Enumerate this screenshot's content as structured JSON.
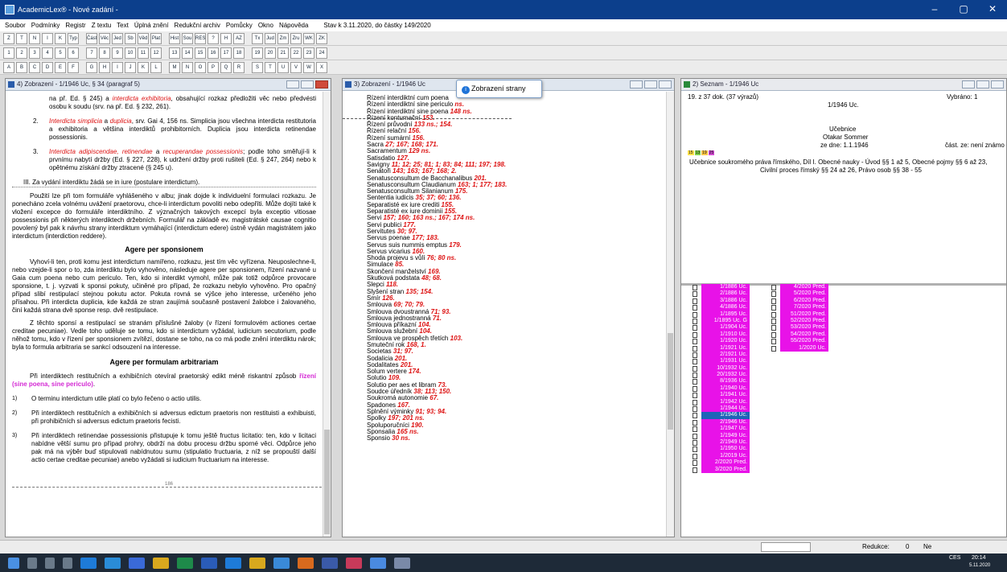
{
  "window": {
    "title": "AcademicLex® - Nové zadání -",
    "icon": "app-icon"
  },
  "menu": {
    "items": [
      "Soubor",
      "Podmínky",
      "Registr",
      "Z textu",
      "Text",
      "Úplná znění",
      "Redukční archiv",
      "Pomůcky",
      "Okno",
      "Nápověda"
    ],
    "stav": "Stav k 3.11.2020, do částky 149/2020"
  },
  "toolbar": {
    "row1": [
      "Z",
      "T",
      "N",
      "I",
      "K",
      "Typ",
      "Část",
      "Věc",
      "Jed",
      "Sb",
      "Věd",
      "Plat",
      "Hist",
      "Sou",
      "RESET",
      "?",
      "H",
      "AZ",
      "Tx",
      "Jud",
      "Zm",
      "Zru",
      "WK",
      "ZK"
    ],
    "row2": [
      "1",
      "2",
      "3",
      "4",
      "5",
      "6",
      "7",
      "8",
      "9",
      "10",
      "11",
      "12",
      "13",
      "14",
      "15",
      "16",
      "17",
      "18",
      "19",
      "20",
      "21",
      "22",
      "23",
      "24"
    ],
    "row3": [
      "A",
      "B",
      "C",
      "D",
      "E",
      "F",
      "G",
      "H",
      "I",
      "J",
      "K",
      "L",
      "M",
      "N",
      "O",
      "P",
      "Q",
      "R",
      "S",
      "T",
      "U",
      "V",
      "W",
      "X"
    ]
  },
  "pane1": {
    "title": "4) Zobrazení - 1/1946 Uc, § 34 (paragraf 5)",
    "p_top": "na př. Ed. § 245) a ",
    "p_top_red": "interdicta exhibitoria",
    "p_top_rest": ", obsahující rozkaz předložiti věc nebo předvésti osobu k soudu (srv. na př. Ed. § 232, 261).",
    "item2_num": "2.",
    "item2_red": "Interdicta simplicia",
    "item2_a": " a ",
    "item2_red2": "duplicia",
    "item2_rest": ", srv. Gai 4, 156 ns. Simplicia jsou všechna interdicta restitutoria a exhibitoria a většina interdiktů prohibitorních. Duplicia jsou interdicta retinendae possessionis.",
    "item3_num": "3.",
    "item3_red": "Interdicta adipiscendae, retinendae",
    "item3_a": " a ",
    "item3_red2": "recuperandae possessionis",
    "item3_rest": "; podle toho směřují-li k prvnímu nabytí držby (Ed. § 227, 228), k udržení držby proti rušiteli (Ed. § 247, 264) nebo k opětnému získání držby ztracené (§ 245 u).",
    "sec3": "III. Za vydání interdiktu žádá se in iure (postulare interdictum).",
    "para1": "Použití lze při tom formuláře vyhlášeného v albu; jinak dojde k individuelní formulaci rozkazu. Je ponecháno zcela volnému uvážení praetorovu, chce-li interdictum povoliti nebo odepříti. Může dojíti také k vložení excepce do formuláře interdiktního. Z význačných takových excepcí byla exceptio vitiosae possessionis při některých interdiktech držebních. Formulář na základě ev. magistrátské causae cognitio povolený byl pak k návrhu strany interdiktum vymáhající (interdictum edere) ústně vydán magistrátem jako interdictum (interdiction reddere).",
    "h1": "Agere per sponsionem",
    "para2": "Vyhoví-li ten, proti komu jest interdictum namířeno, rozkazu, jest tím věc vyřízena. Neuposlechne-li, nebo vzejde-li spor o to, zda interdiktu bylo vyhověno, následuje agere per sponsionem, řízení nazvané u Gaia cum poena nebo cum periculo. Ten, kdo si interdikt vymohl, může pak totiž odpůrce provocare sponsione, t. j. vyzvati k sponsi pokuty, učiněné pro případ, že rozkazu nebylo vyhověno. Pro opačný případ slibí restipulací stejnou pokutu actor. Pokuta rovná se výšce jeho interesse, určeného jeho přísahou. Při interdicta duplicia, kde každá ze stran zaujímá současně postavení žalobce i žalovaného, činí každá strana dvě sponse resp. dvě restipulace.",
    "para3": "Z těchto sponsí a restipulací se stranám příslušné žaloby (v řízení formulovém actiones certae creditae pecuniae). Vedle toho uděluje se tomu, kdo si interdictum vyžádal, iudicium secutorium, podle něhož tomu, kdo v řízení per sponsionem zvítězí, dostane se toho, na co má podle znění interdiktu nárok; byla to formula arbitraria se sankcí odsouzení na interesse.",
    "h2": "Agere per formulam arbitrariam",
    "para4a": "Při interdiktech restitučních a exhibičních otevíral praetorský edikt méně riskantní způsob ",
    "para4hl": "řízení (sine poena, sine periculo)",
    "para4b": ".",
    "fn1": "O terminu interdictum utile platí co bylo řečeno o actio utilis.",
    "fn1hl": "interdictum",
    "fn2": "Při interdiktech restitučních a exhibičních si adversus edictum praetoris non restituisti a exhibuisti, při prohibičních si adversus edictum praetoris fecisti.",
    "fn3": "Při interdiktech retinendae possessionis přistupuje k tomu ještě fructus licitatio: ten, kdo v licitaci nabídne větší sumu pro případ prohry, obdrží na dobu procesu držbu sporné věci. Odpůrce jeho pak má na výběr buď stipulovati nabídnutou sumu (stipulatio fructuaria, z níž se propouští další actio certae creditae pecuniae) anebo vyžádati si iudicium fructuarium na interesse.",
    "fnmarks": [
      "1)",
      "2)",
      "3)"
    ],
    "pageno": "186"
  },
  "pane2": {
    "title": "3) Zobrazení - 1/1946 Uc",
    "tooltip": "Zobrazení strany",
    "items": [
      [
        "Řízení interdiktní cum poena",
        ""
      ],
      [
        "Řízení interdiktní sine periculo",
        "ns."
      ],
      [
        "Řízení interdiktní sine poena",
        "148 ns."
      ],
      [
        "Řízení kontumační",
        "153."
      ],
      [
        "Řízení průvodní",
        "133 ns.; 154."
      ],
      [
        "Řízení relační",
        "156."
      ],
      [
        "Řízení sumární",
        "156."
      ],
      [
        "Sacra",
        "27; 167; 168; 171."
      ],
      [
        "Sacramentum",
        "129 ns."
      ],
      [
        "Satisdatio",
        "127."
      ],
      [
        "Savigny",
        "11; 12; 25; 81; 1; 83; 84; 111; 197; 198."
      ],
      [
        "Senátoři",
        "143; 163; 167; 168; 2."
      ],
      [
        "Senatusconsultum de Bacchanalibus",
        "201."
      ],
      [
        "Senatusconsultum Claudianum",
        "163; 1; 177; 183."
      ],
      [
        "Senatusconsultum Silanianum",
        "175."
      ],
      [
        "Sententia iudicis",
        "35; 37; 60; 136."
      ],
      [
        "Separatisté ex iure crediti",
        "155."
      ],
      [
        "Separatisté ex iure dominii",
        "155."
      ],
      [
        "Servi",
        "157; 160; 163 ns.; 167; 174 ns."
      ],
      [
        "Servi publici",
        "177."
      ],
      [
        "Servitutes",
        "30; 97."
      ],
      [
        "Servus poenae",
        "177; 183."
      ],
      [
        "Servus suis nummis emptus",
        "179."
      ],
      [
        "Servus vicarius",
        "160."
      ],
      [
        "Shoda projevu s vůlí",
        "76; 80 ns."
      ],
      [
        "Simulace",
        "85."
      ],
      [
        "Skončení manželství",
        "169."
      ],
      [
        "Skutková podstata",
        "48; 68."
      ],
      [
        "Slepci",
        "118."
      ],
      [
        "Slyšení stran",
        "135; 154."
      ],
      [
        "Smír",
        "126."
      ],
      [
        "Smlouva",
        "69; 70; 79."
      ],
      [
        "Smlouva dvoustranná",
        "71; 93."
      ],
      [
        "Smlouva jednostranná",
        "71."
      ],
      [
        "Smlouva příkazní",
        "104."
      ],
      [
        "Smlouva služební",
        "104."
      ],
      [
        "Smlouva ve prospěch třetích",
        "103."
      ],
      [
        "Smuteční rok",
        "168, 1."
      ],
      [
        "Societas",
        "31; 97."
      ],
      [
        "Sodalicia",
        "201."
      ],
      [
        "Sodalitates",
        "201."
      ],
      [
        "Solum vertere",
        "174."
      ],
      [
        "Solutio",
        "109."
      ],
      [
        "Solutio per aes et libram",
        "73."
      ],
      [
        "Soudce úředník",
        "38; 113; 150."
      ],
      [
        "Soukromá autonomie",
        "67."
      ],
      [
        "Spadones",
        "167."
      ],
      [
        "Splnění výminky",
        "91; 93; 94."
      ],
      [
        "Spolky",
        "197; 201 ns."
      ],
      [
        "Spoluporučníci",
        "190."
      ],
      [
        "Sponsalia",
        "165 ns."
      ],
      [
        "Sponsio",
        "30 ns."
      ]
    ]
  },
  "pane3": {
    "title": "2) Seznam - 1/1946 Uc",
    "count": "19. z 37 dok. (37 výrazů)",
    "doc": "1/1946 Uc.",
    "selected": "Vybráno: 1",
    "type": "Učebnice",
    "author": "Otakar Sommer",
    "date": "ze dne: 1.1.1946",
    "part": "část. ze: není známo",
    "badges": [
      "15",
      "13",
      "19",
      "25"
    ],
    "desc1": "Učebnice soukromého práva římského, Díl I. Obecné nauky - Úvod §§ 1 až 5, Obecné pojmy §§ 6 až 23,",
    "desc2": "Civilní proces římský §§ 24 až 26, Právo osob §§ 38 - 55"
  },
  "doclist": {
    "col1": [
      "1/1886 Uc.",
      "2/1886 Uc.",
      "3/1886 Uc.",
      "4/1886 Uc.",
      "1/1895 Uc.",
      "1/1895 Uc. G",
      "1/1904 Uc.",
      "1/1910 Uc.",
      "1/1920 Uc.",
      "1/1921 Uc.",
      "2/1921 Uc.",
      "1/1931 Uc.",
      "10/1932 Uc.",
      "20/1932 Uc.",
      "8/1936 Uc.",
      "1/1940 Uc.",
      "1/1941 Uc.",
      "1/1942 Uc.",
      "1/1944 Uc.",
      "1/1946 Uc.",
      "2/1946 Uc.",
      "1/1947 Uc.",
      "1/1949 Uc.",
      "2/1949 Uc.",
      "1/1950 Uc.",
      "1/2019 Uc.",
      "2/2020 Pred.",
      "3/2020 Pred."
    ],
    "col2": [
      "4/2020 Pred.",
      "5/2020 Pred.",
      "6/2020 Pred.",
      "7/2020 Pred.",
      "51/2020 Pred.",
      "52/2020 Pred.",
      "53/2020 Pred.",
      "54/2020 Pred.",
      "55/2020 Pred.",
      "1/2020 Uc."
    ],
    "selected_index": 19
  },
  "status": {
    "redukce_label": "Redukce:",
    "redukce_value": "0",
    "ne": "Ne"
  },
  "tray": {
    "lang": "CES",
    "time": "20:14",
    "date": "5.11.2020"
  },
  "colors": {
    "titlebar": "#0c3f8c",
    "accent_red": "#dd1111",
    "magenta": "#e812e8",
    "select": "#1e64b8"
  }
}
